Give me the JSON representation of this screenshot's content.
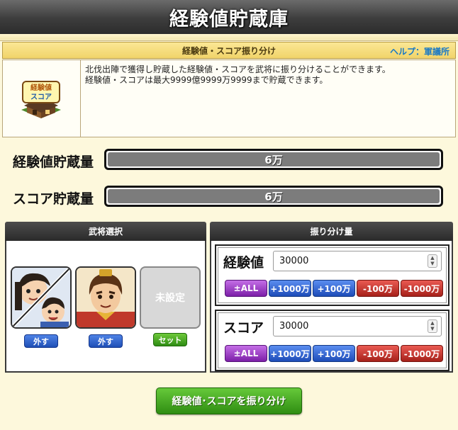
{
  "page": {
    "title": "経験値貯蔵庫"
  },
  "section": {
    "heading": "経験値・スコア振り分け",
    "help_link": "ヘルプ：軍議所",
    "icon_label_top": "経験値",
    "icon_label_bottom": "スコア",
    "description_line1": "北伐出陣で獲得し貯蔵した経験値・スコアを武将に振り分けることができます。",
    "description_line2": "経験値・スコアは最大9999億9999万9999まで貯蔵できます。"
  },
  "balances": {
    "exp_label": "経験値貯蔵量",
    "exp_value": "6万",
    "score_label": "スコア貯蔵量",
    "score_value": "6万"
  },
  "general_select": {
    "heading": "武将選択",
    "slots": [
      {
        "button": "外す"
      },
      {
        "button": "外す"
      },
      {
        "placeholder": "未設定",
        "button": "セット"
      }
    ]
  },
  "allocation": {
    "heading": "振り分け量",
    "rows": [
      {
        "label": "経験値",
        "value": "30000"
      },
      {
        "label": "スコア",
        "value": "30000"
      }
    ],
    "buttons": [
      "±ALL",
      "+1000万",
      "+100万",
      "-100万",
      "-1000万"
    ]
  },
  "submit_label": "経験値･スコアを振り分け",
  "colors": {
    "title_bar": "#3d3d3d",
    "panel_bg": "#fdf8dc",
    "help_link": "#1778c6",
    "balance_fill": "#7c7c7c"
  }
}
